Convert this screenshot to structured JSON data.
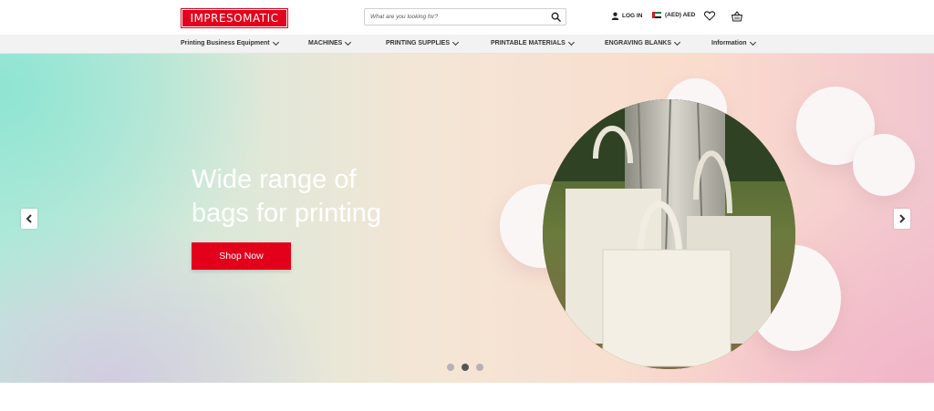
{
  "header": {
    "logo_text": "IMPRESOMATIC",
    "search_placeholder": "What are you looking for?",
    "login_label": "LOG IN",
    "currency_label": "(AED) AED",
    "icons": [
      "search-icon",
      "user-icon",
      "uae-flag-icon",
      "heart-icon",
      "basket-icon"
    ]
  },
  "nav": {
    "items": [
      {
        "label": "Printing Business Equipment"
      },
      {
        "label": "MACHINES"
      },
      {
        "label": "PRINTING SUPPLIES"
      },
      {
        "label": "PRINTABLE MATERIALS"
      },
      {
        "label": "ENGRAVING BLANKS"
      },
      {
        "label": "Information"
      }
    ]
  },
  "hero": {
    "title_line1": "Wide range of",
    "title_line2": "bags for printing",
    "cta_label": "Shop Now",
    "slides_total": 3,
    "active_slide": 2
  },
  "colors": {
    "brand_red": "#e3001b",
    "nav_bg": "#f2f2f2"
  }
}
